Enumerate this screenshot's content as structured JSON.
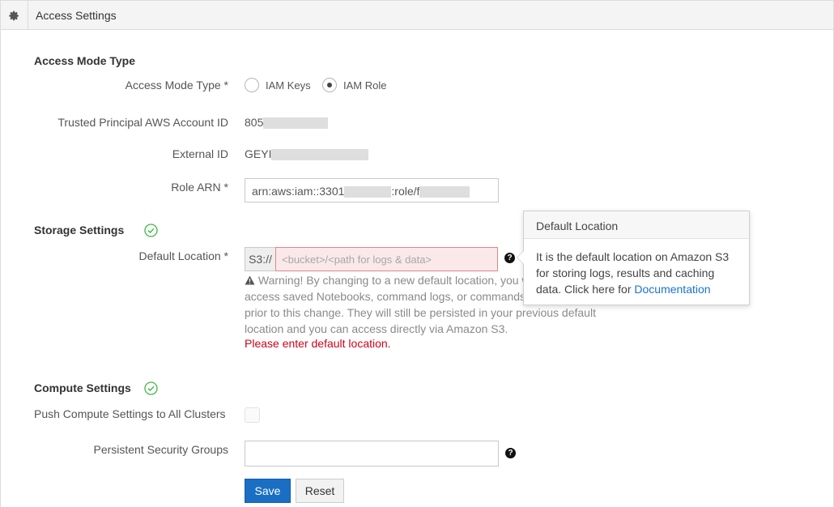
{
  "header": {
    "title": "Access Settings",
    "icon": "gear-icon"
  },
  "access_mode": {
    "section_title": "Access Mode Type",
    "mode_label": "Access Mode Type *",
    "options": [
      {
        "label": "IAM Keys",
        "selected": false
      },
      {
        "label": "IAM Role",
        "selected": true
      }
    ],
    "trusted_label": "Trusted Principal AWS Account ID",
    "trusted_value": "805",
    "external_label": "External ID",
    "external_value": "GEYI",
    "role_arn_label": "Role ARN *",
    "role_arn_part1": "arn:aws:iam::3301",
    "role_arn_part2": ":role/f"
  },
  "storage": {
    "section_title": "Storage Settings",
    "default_location_label": "Default Location *",
    "prefix": "S3://",
    "placeholder": "<bucket>/<path for logs & data>",
    "warning": "Warning! By changing to a new default location, you will not be able to access saved Notebooks, command logs, or commands results saved in S3 prior to this change. They will still be persisted in your previous default location and you can access directly via Amazon S3.",
    "error": "Please enter default location."
  },
  "popover": {
    "title": "Default Location",
    "body": "It is the default location on Amazon S3 for storing logs, results and caching data. Click here for ",
    "link": "Documentation"
  },
  "compute": {
    "section_title": "Compute Settings",
    "push_label": "Push Compute Settings to All Clusters",
    "push_checked": false,
    "security_groups_label": "Persistent Security Groups",
    "security_groups_value": ""
  },
  "actions": {
    "save": "Save",
    "reset": "Reset"
  },
  "colors": {
    "primary": "#1a6fc4",
    "error": "#d0021b",
    "success": "#3db83d",
    "link": "#1a73c8"
  }
}
